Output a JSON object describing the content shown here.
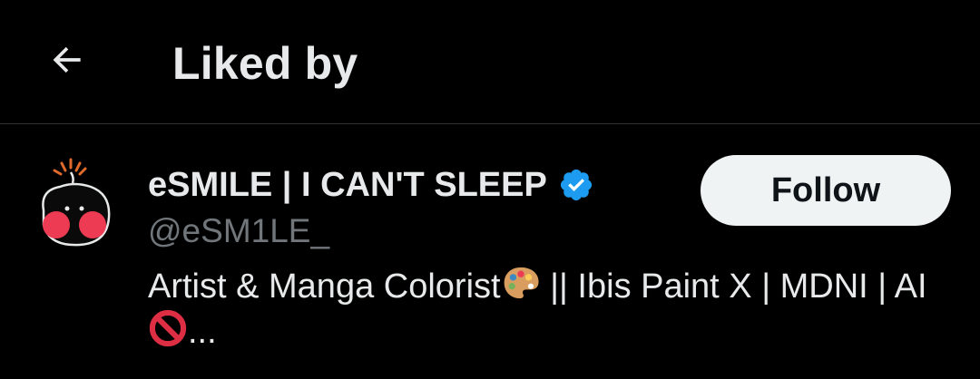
{
  "header": {
    "title": "Liked by",
    "back_icon": "arrow-left-icon"
  },
  "users": [
    {
      "display_name": "eSMILE | I CAN'T SLEEP",
      "verified": true,
      "verified_color": "#1d9bf0",
      "handle": "@eSM1LE_",
      "bio_part1": "Artist & Manga Colorist",
      "bio_part2": " || Ibis Paint X | MDNI | AI ",
      "bio_part3": "...",
      "bio_emojis": [
        "palette-emoji",
        "prohibited-emoji"
      ],
      "follow_label": "Follow"
    }
  ],
  "colors": {
    "background": "#000000",
    "primary_text": "#e7e9ea",
    "secondary_text": "#71767b",
    "divider": "#2f3336",
    "follow_bg": "#eff3f4",
    "follow_text": "#0f1419"
  }
}
